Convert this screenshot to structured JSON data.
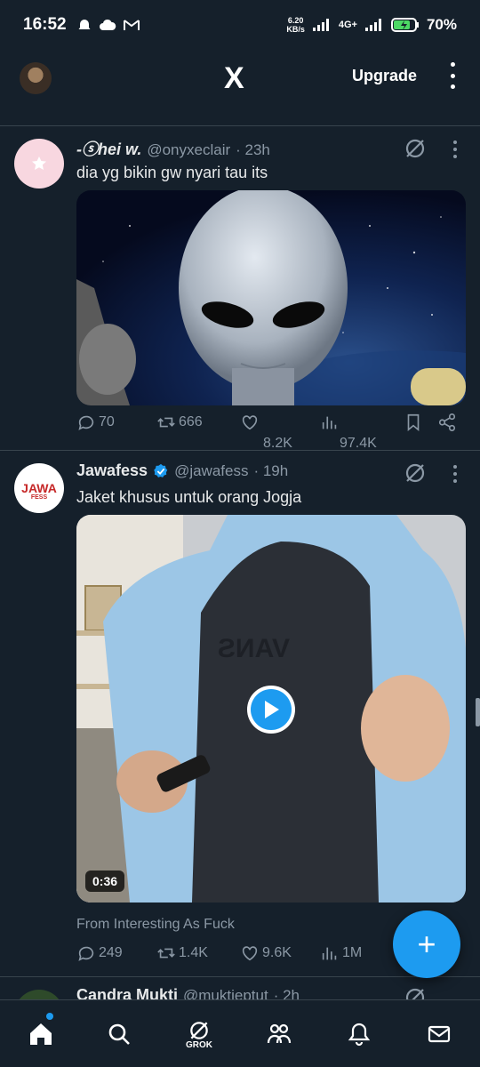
{
  "status_bar": {
    "time": "16:52",
    "net_speed_value": "6.20",
    "net_speed_unit": "KB/s",
    "network_type": "4G+",
    "battery": "70%"
  },
  "app_header": {
    "logo": "X",
    "upgrade_label": "Upgrade"
  },
  "tweets": [
    {
      "name": "-ⓢhei w.",
      "handle": "@onyxeclair",
      "time": "· 23h",
      "text": "dia yg bikin gw nyari tau its",
      "replies": "70",
      "retweets": "666",
      "likes": "8.2K",
      "views": "97.4K"
    },
    {
      "name": "Jawafess",
      "verified": true,
      "handle": "@jawafess",
      "time": "· 19h",
      "text": "Jaket khusus untuk orang Jogja",
      "video_duration": "0:36",
      "source": "From Interesting As Fuck",
      "replies": "249",
      "retweets": "1.4K",
      "likes": "9.6K",
      "views": "1M",
      "avatar_text_top": "JAWA",
      "avatar_text_bottom": "FESS"
    },
    {
      "name": "Candra Mukti",
      "handle": "@muktieptut",
      "time": "· 2h"
    }
  ],
  "bottom_nav": {
    "grok_label": "GROK"
  },
  "colors": {
    "background": "#15202b",
    "accent": "#1d9bf0",
    "muted_text": "#8b98a5",
    "divider": "#38444d"
  }
}
